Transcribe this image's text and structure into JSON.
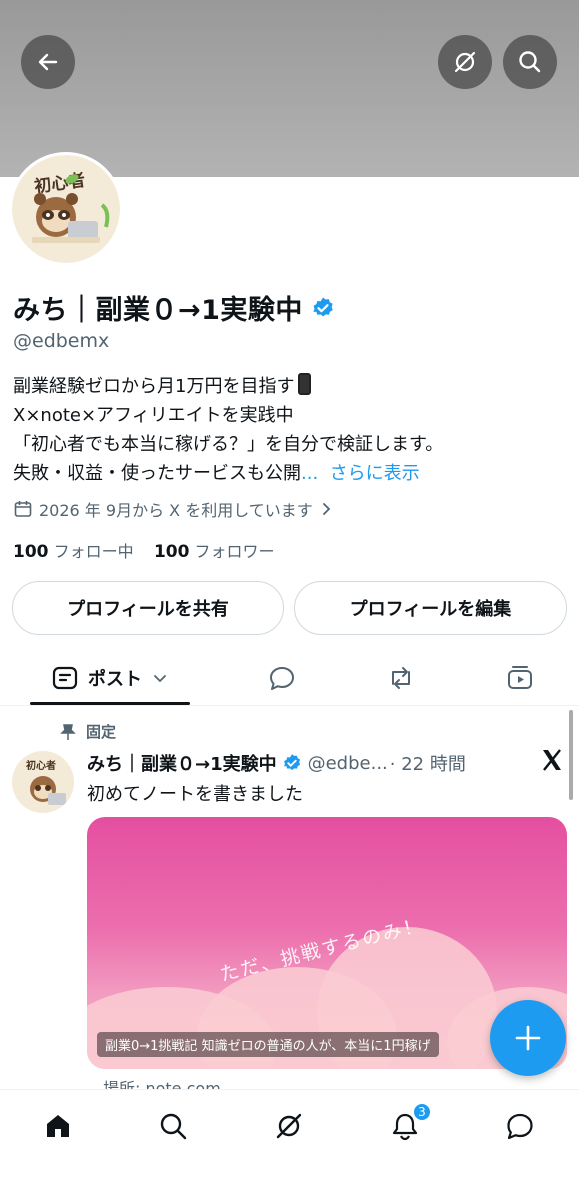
{
  "header": {
    "back_icon": "arrow-left-icon",
    "grok_icon": "grok-icon",
    "search_icon": "search-icon"
  },
  "profile": {
    "avatar_label": "初心者",
    "display_name": "みち｜副業０→1実験中",
    "handle": "@edbemx",
    "bio_lines": [
      "副業経験ゼロから月1万円を目指す",
      "X×note×アフィリエイトを実践中",
      "「初心者でも本当に稼げる？」を自分で検証します。",
      "失敗・収益・使ったサービスも公開"
    ],
    "bio_ellipsis": "...",
    "show_more": "さらに表示",
    "joined": "2026 年 9月から X を利用しています",
    "following_count": "100",
    "following_label": "フォロー中",
    "followers_count": "100",
    "followers_label": "フォロワー",
    "share_button": "プロフィールを共有",
    "edit_button": "プロフィールを編集"
  },
  "tabs": {
    "posts_label": "ポスト",
    "icons": [
      "posts-icon",
      "reply-icon",
      "repost-icon",
      "media-icon"
    ]
  },
  "pinned_tweet": {
    "pinned_label": "固定",
    "author_name": "みち｜副業０→1実験中",
    "author_handle": "@edbe...",
    "time": "· 22 時間",
    "text": "初めてノートを書きました",
    "card_overlay_text": "ただ、挑戦するのみ！",
    "card_caption": "副業0→1挑戦記 知識ゼロの普通の人が、本当に1円稼げ",
    "source": "場所: note.com"
  },
  "bottom_nav": {
    "items": [
      "home-icon",
      "search-icon",
      "grok-icon",
      "notifications-icon",
      "messages-icon"
    ],
    "notification_badge": "3"
  },
  "colors": {
    "accent": "#1d9bf0",
    "text": "#0f1419",
    "muted": "#536471",
    "banner": "#a6a6a6"
  }
}
